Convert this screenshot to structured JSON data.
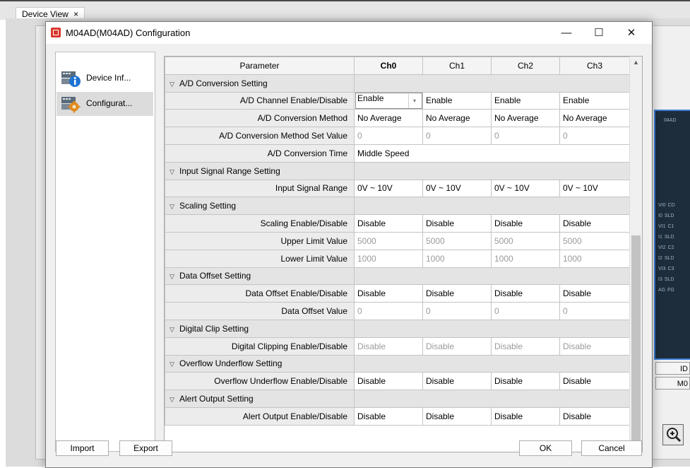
{
  "background": {
    "tab_label": "Device View",
    "tab_close": "×",
    "module_labels": [
      "04AD",
      "VI0",
      "CD",
      "I0",
      "SLD",
      "VI1",
      "C1",
      "I1",
      "SLD",
      "VI2",
      "C2",
      "I2",
      "SLD",
      "VI3",
      "C3",
      "I3",
      "SLD",
      "AG",
      "FG"
    ],
    "id_label": "ID",
    "m0_label": "M0"
  },
  "dialog": {
    "title": "M04AD(M04AD) Configuration",
    "minimize": "—",
    "maximize": "☐",
    "close": "✕"
  },
  "sidebar": {
    "items": [
      {
        "label": "Device Inf...",
        "icon": "device-info-icon"
      },
      {
        "label": "Configurat...",
        "icon": "configuration-gear-icon"
      }
    ]
  },
  "grid": {
    "headers": [
      "Parameter",
      "Ch0",
      "Ch1",
      "Ch2",
      "Ch3"
    ],
    "rows": [
      {
        "type": "section",
        "label": "A/D Conversion Setting"
      },
      {
        "type": "param",
        "label": "A/D Channel Enable/Disable",
        "values": [
          "Enable",
          "Enable",
          "Enable",
          "Enable"
        ],
        "dropdown": true
      },
      {
        "type": "param",
        "label": "A/D Conversion Method",
        "values": [
          "No Average",
          "No Average",
          "No Average",
          "No Average"
        ]
      },
      {
        "type": "param",
        "label": "A/D Conversion Method Set Value",
        "values": [
          "0",
          "0",
          "0",
          "0"
        ],
        "disabled": true
      },
      {
        "type": "param",
        "label": "A/D Conversion Time",
        "span_value": "Middle Speed"
      },
      {
        "type": "section",
        "label": "Input Signal Range Setting"
      },
      {
        "type": "param",
        "label": "Input Signal Range",
        "values": [
          "0V ~ 10V",
          "0V ~ 10V",
          "0V ~ 10V",
          "0V ~ 10V"
        ]
      },
      {
        "type": "section",
        "label": "Scaling Setting"
      },
      {
        "type": "param",
        "label": "Scaling Enable/Disable",
        "values": [
          "Disable",
          "Disable",
          "Disable",
          "Disable"
        ]
      },
      {
        "type": "param",
        "label": "Upper Limit Value",
        "values": [
          "5000",
          "5000",
          "5000",
          "5000"
        ],
        "disabled": true
      },
      {
        "type": "param",
        "label": "Lower Limit Value",
        "values": [
          "1000",
          "1000",
          "1000",
          "1000"
        ],
        "disabled": true
      },
      {
        "type": "section",
        "label": "Data Offset Setting"
      },
      {
        "type": "param",
        "label": "Data Offset Enable/Disable",
        "values": [
          "Disable",
          "Disable",
          "Disable",
          "Disable"
        ]
      },
      {
        "type": "param",
        "label": "Data Offset Value",
        "values": [
          "0",
          "0",
          "0",
          "0"
        ],
        "disabled": true
      },
      {
        "type": "section",
        "label": "Digital Clip Setting"
      },
      {
        "type": "param",
        "label": "Digital Clipping Enable/Disable",
        "values": [
          "Disable",
          "Disable",
          "Disable",
          "Disable"
        ],
        "disabled": true
      },
      {
        "type": "section",
        "label": "Overflow Underflow Setting"
      },
      {
        "type": "param",
        "label": "Overflow Underflow Enable/Disable",
        "values": [
          "Disable",
          "Disable",
          "Disable",
          "Disable"
        ]
      },
      {
        "type": "section",
        "label": "Alert Output Setting"
      },
      {
        "type": "param",
        "label": "Alert Output Enable/Disable",
        "values": [
          "Disable",
          "Disable",
          "Disable",
          "Disable"
        ]
      }
    ]
  },
  "buttons": {
    "import": "Import",
    "export": "Export",
    "ok": "OK",
    "cancel": "Cancel"
  },
  "colors": {
    "section_bg": "#e4e4e4",
    "param_bg": "#ececec",
    "disabled_text": "#9a9a9a",
    "module_border": "#3d7cd6"
  }
}
